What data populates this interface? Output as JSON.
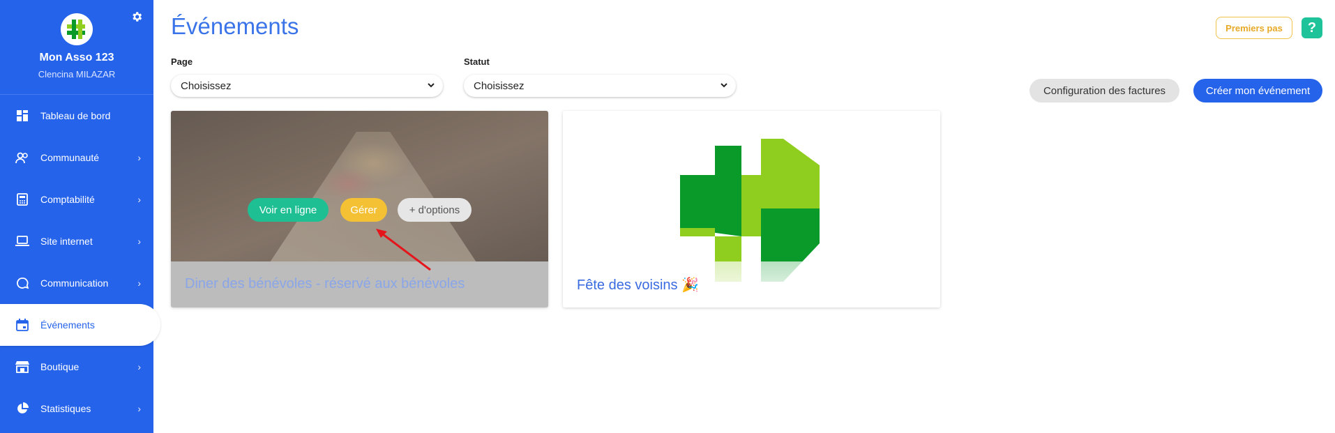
{
  "app": {
    "org_name": "Mon Asso 123",
    "user_name": "Clencina MILAZAR",
    "brand_color": "#2563eb"
  },
  "sidebar": {
    "items": [
      {
        "label": "Tableau de bord",
        "icon": "dashboard-icon",
        "has_submenu": false,
        "active": false
      },
      {
        "label": "Communauté",
        "icon": "people-icon",
        "has_submenu": true,
        "active": false
      },
      {
        "label": "Comptabilité",
        "icon": "calculator-icon",
        "has_submenu": true,
        "active": false
      },
      {
        "label": "Site internet",
        "icon": "laptop-icon",
        "has_submenu": true,
        "active": false
      },
      {
        "label": "Communication",
        "icon": "chat-icon",
        "has_submenu": true,
        "active": false
      },
      {
        "label": "Événements",
        "icon": "calendar-icon",
        "has_submenu": false,
        "active": true
      },
      {
        "label": "Boutique",
        "icon": "store-icon",
        "has_submenu": true,
        "active": false
      },
      {
        "label": "Statistiques",
        "icon": "pie-chart-icon",
        "has_submenu": true,
        "active": false
      }
    ]
  },
  "header": {
    "title": "Événements",
    "premiers_pas": "Premiers pas",
    "help": "?"
  },
  "filters": {
    "page_label": "Page",
    "page_value": "Choisissez",
    "statut_label": "Statut",
    "statut_value": "Choisissez"
  },
  "actions": {
    "config_factures": "Configuration des factures",
    "creer_evenement": "Créer mon événement"
  },
  "events": [
    {
      "title": "Diner des bénévoles - réservé aux bénévoles",
      "actions": [
        "Voir en ligne",
        "Gérer",
        "+ d'options"
      ]
    },
    {
      "title": "Fête des voisins 🎉"
    }
  ]
}
